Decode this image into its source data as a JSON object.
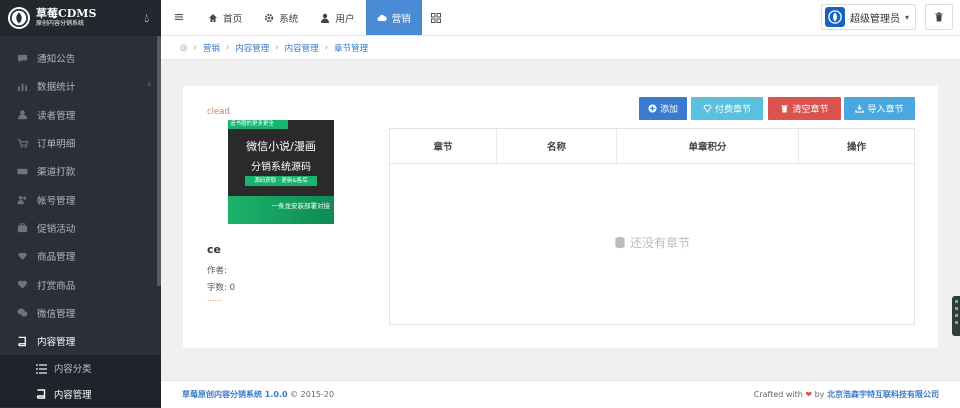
{
  "brand": {
    "title": "草莓CDMS",
    "subtitle": "原创内容分销系统"
  },
  "sidebar": {
    "items": [
      {
        "label": "通知公告",
        "icon": "comment-icon"
      },
      {
        "label": "数据统计",
        "icon": "bar-chart-icon"
      },
      {
        "label": "读者管理",
        "icon": "user-icon"
      },
      {
        "label": "订单明细",
        "icon": "cart-icon"
      },
      {
        "label": "渠道打款",
        "icon": "keyboard-icon"
      },
      {
        "label": "帐号管理",
        "icon": "users-icon"
      },
      {
        "label": "促销活动",
        "icon": "briefcase-icon"
      },
      {
        "label": "商品管理",
        "icon": "diamond-icon"
      },
      {
        "label": "打赏商品",
        "icon": "heart-icon"
      },
      {
        "label": "微信管理",
        "icon": "wechat-icon"
      },
      {
        "label": "内容管理",
        "icon": "book-icon"
      }
    ],
    "sub_items": [
      {
        "label": "内容分类",
        "icon": "list-icon"
      },
      {
        "label": "内容管理",
        "icon": "book-icon"
      }
    ]
  },
  "topbar": {
    "nav": [
      {
        "label": "首页",
        "icon": "home-icon"
      },
      {
        "label": "系统",
        "icon": "gear-icon"
      },
      {
        "label": "用户",
        "icon": "user-icon"
      },
      {
        "label": "营销",
        "icon": "cloud-icon"
      }
    ],
    "user_label": "超级管理员"
  },
  "breadcrumb": [
    "营销",
    "内容管理",
    "内容管理",
    "章节管理"
  ],
  "book": {
    "tag": "clead",
    "cover": {
      "top": "追书圈的更多更全",
      "line1": "微信小说/漫画",
      "line2": "分销系统源码",
      "line3": "源码获取 · 更新&售后",
      "line4": "一条龙安装部署对接"
    },
    "title": "ce",
    "author": "作者:",
    "count": "字数: 0",
    "more": "......"
  },
  "buttons": {
    "add": "添加",
    "paid": "付费章节",
    "clear": "清空章节",
    "import": "导入章节"
  },
  "table": {
    "headers": [
      "章节",
      "名称",
      "单章积分",
      "操作"
    ],
    "empty": "还没有章节"
  },
  "footer": {
    "brand": "草莓原创内容分销系统 1.0.0",
    "copyright": "© 2015-20",
    "crafted": "Crafted with",
    "by": "by",
    "company": "北京浩森宇特互联科技有限公司"
  }
}
